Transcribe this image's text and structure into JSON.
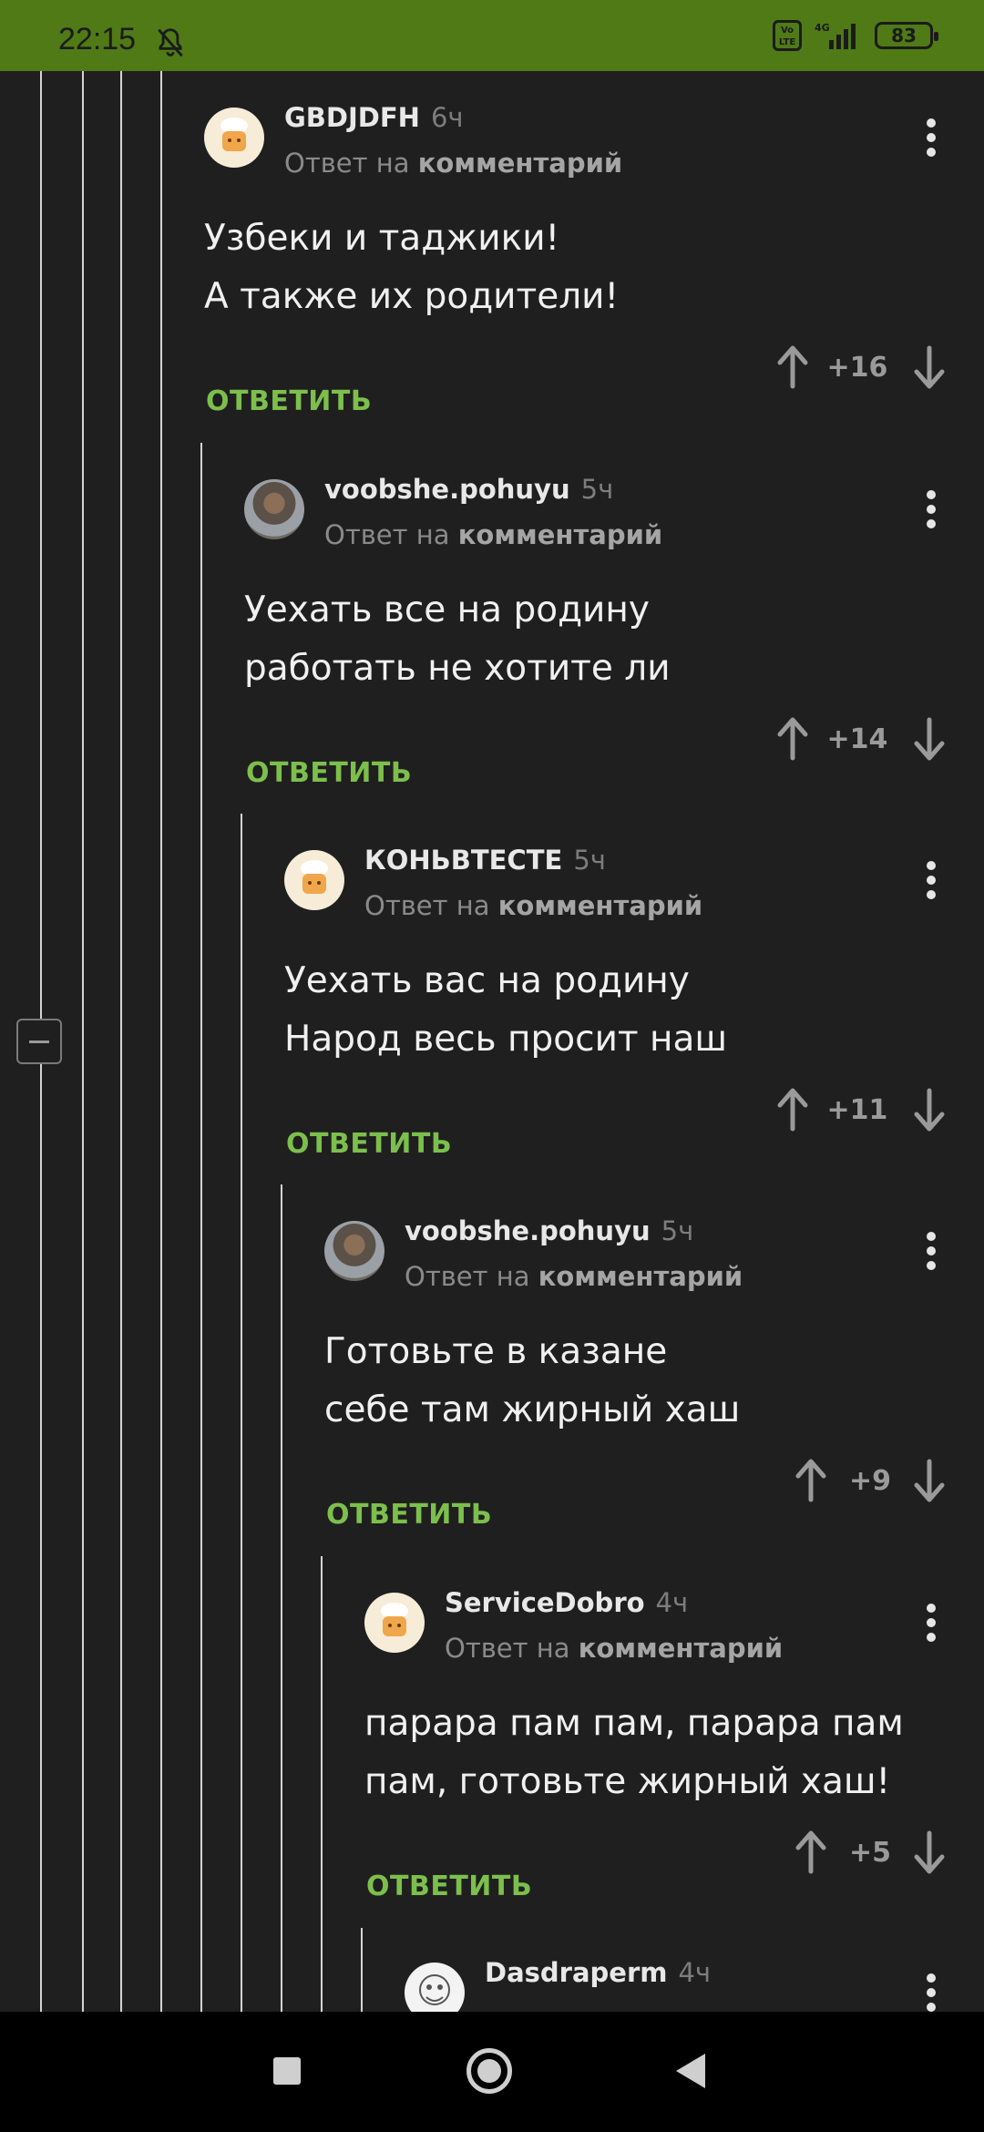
{
  "status_bar": {
    "time": "22:15",
    "volte": "VoLTE",
    "network": "4G",
    "battery": "83"
  },
  "reply_prefix": "Ответ на",
  "reply_link": "комментарий",
  "reply_button": "ОТВЕТИТЬ",
  "comments": [
    {
      "user": "GBDJDFH",
      "time": "6ч",
      "lines": [
        "Узбеки и таджики!",
        "А также их родители!"
      ],
      "score": "+16"
    },
    {
      "user": "voobshe.pohuyu",
      "time": "5ч",
      "lines": [
        "Уехать все на родину",
        "работать не хотите ли"
      ],
      "score": "+14"
    },
    {
      "user": "КОНЬВТЕСТЕ",
      "time": "5ч",
      "lines": [
        "Уехать вас на родину",
        "Народ весь просит наш"
      ],
      "score": "+11"
    },
    {
      "user": "voobshe.pohuyu",
      "time": "5ч",
      "lines": [
        "Готовьте в казане",
        "себе там жирный хаш"
      ],
      "score": "+9"
    },
    {
      "user": "ServiceDobro",
      "time": "4ч",
      "lines": [
        "парара пам пам, парара пам",
        "пам, готовьте жирный хаш!"
      ],
      "score": "+5"
    },
    {
      "user": "Dasdraperm",
      "time": "4ч"
    }
  ]
}
